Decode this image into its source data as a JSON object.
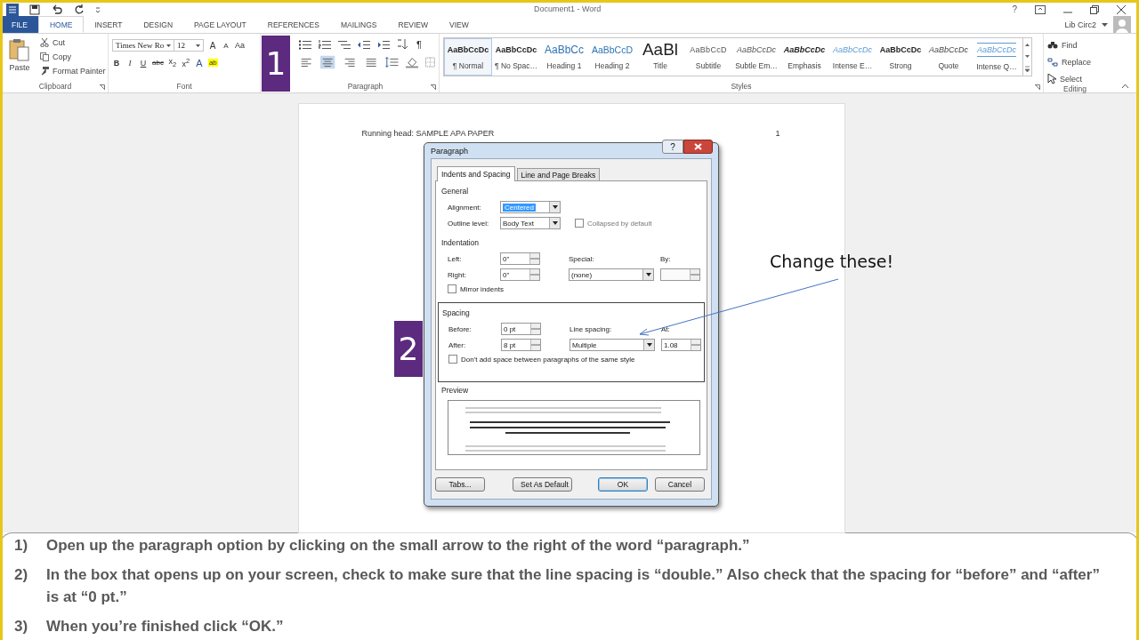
{
  "window": {
    "title": "Document1 - Word",
    "help": "?",
    "user": "Lib Circ2"
  },
  "ribbon_tabs": [
    {
      "label": "FILE",
      "kind": "file",
      "selected": false
    },
    {
      "label": "HOME",
      "kind": "tab",
      "selected": true
    },
    {
      "label": "INSERT",
      "kind": "tab",
      "selected": false
    },
    {
      "label": "DESIGN",
      "kind": "tab",
      "selected": false
    },
    {
      "label": "PAGE LAYOUT",
      "kind": "tab",
      "selected": false
    },
    {
      "label": "REFERENCES",
      "kind": "tab",
      "selected": false
    },
    {
      "label": "MAILINGS",
      "kind": "tab",
      "selected": false
    },
    {
      "label": "REVIEW",
      "kind": "tab",
      "selected": false
    },
    {
      "label": "VIEW",
      "kind": "tab",
      "selected": false
    }
  ],
  "clipboard": {
    "paste": "Paste",
    "cut": "Cut",
    "copy": "Copy",
    "format_painter": "Format Painter",
    "group_label": "Clipboard"
  },
  "font": {
    "name": "Times New Ro",
    "size": "12",
    "grow": "A",
    "shrink": "A",
    "change_case": "Aa",
    "group_label": "Font",
    "buttons": [
      {
        "label": "B",
        "kind": "bold"
      },
      {
        "label": "I",
        "kind": "italic"
      },
      {
        "label": "U",
        "kind": "underline"
      },
      {
        "label": "abc",
        "kind": "strike"
      },
      {
        "label": "x$_{2}$",
        "kind": "plain"
      },
      {
        "label": "x$^{2}$",
        "kind": "plain"
      },
      {
        "label": "A",
        "kind": "effects"
      },
      {
        "label": "ab",
        "kind": "highlight"
      }
    ]
  },
  "paragraph": {
    "group_label": "Paragraph",
    "pilcrow": "¶",
    "alignments": [
      {
        "selected": false
      },
      {
        "selected": true
      },
      {
        "selected": false
      },
      {
        "selected": false
      }
    ]
  },
  "styles": {
    "group_label": "Styles",
    "items": [
      {
        "preview": "AaBbCcDc",
        "label": "¶ Normal",
        "kind": "normal",
        "selected": true
      },
      {
        "preview": "AaBbCcDc",
        "label": "¶ No Spac…",
        "kind": "normal",
        "selected": false
      },
      {
        "preview": "AaBbCc",
        "label": "Heading 1",
        "kind": "heading1",
        "selected": false
      },
      {
        "preview": "AaBbCcD",
        "label": "Heading 2",
        "kind": "heading2",
        "selected": false
      },
      {
        "preview": "AaBl",
        "label": "Title",
        "kind": "title",
        "selected": false
      },
      {
        "preview": "AaBbCcD",
        "label": "Subtitle",
        "kind": "subtitle",
        "selected": false
      },
      {
        "preview": "AaBbCcDc",
        "label": "Subtle Em…",
        "kind": "subtle",
        "selected": false
      },
      {
        "preview": "AaBbCcDc",
        "label": "Emphasis",
        "kind": "emphasis",
        "selected": false
      },
      {
        "preview": "AaBbCcDc",
        "label": "Intense E…",
        "kind": "intense",
        "selected": false
      },
      {
        "preview": "AaBbCcDc",
        "label": "Strong",
        "kind": "strong",
        "selected": false
      },
      {
        "preview": "AaBbCcDc",
        "label": "Quote",
        "kind": "quote",
        "selected": false
      },
      {
        "preview": "AaBbCcDc",
        "label": "Intense Q…",
        "kind": "intense_quote",
        "selected": false
      }
    ]
  },
  "editing": {
    "find": "Find",
    "replace": "Replace",
    "select": "Select",
    "group_label": "Editing"
  },
  "callouts": [
    {
      "label": "1"
    },
    {
      "label": "2"
    }
  ],
  "document": {
    "running_head": "Running head: SAMPLE APA PAPER",
    "page_number": "1"
  },
  "dialog": {
    "title": "Paragraph",
    "help": "?",
    "tabs": [
      {
        "label": "Indents and Spacing",
        "selected": true
      },
      {
        "label": "Line and Page Breaks",
        "selected": false
      }
    ],
    "general": {
      "heading": "General",
      "alignment_label": "Alignment:",
      "alignment": "Centered",
      "outline_label": "Outline level:",
      "outline": "Body Text",
      "collapsed": {
        "label": "Collapsed by default",
        "checked": false
      }
    },
    "indentation": {
      "heading": "Indentation",
      "left_label": "Left:",
      "left": "0\"",
      "right_label": "Right:",
      "right": "0\"",
      "special_label": "Special:",
      "special": "(none)",
      "by_label": "By:",
      "mirror": {
        "label": "Mirror indents",
        "checked": false
      }
    },
    "spacing": {
      "heading": "Spacing",
      "before_label": "Before:",
      "before": "0 pt",
      "after_label": "After:",
      "after": "8 pt",
      "line_label": "Line spacing:",
      "line": "Multiple",
      "at_label": "At:",
      "at": "1.08",
      "dont_add": {
        "label": "Don't add space between paragraphs of the same style",
        "checked": false
      }
    },
    "preview_heading": "Preview",
    "buttons": [
      {
        "label": "Tabs...",
        "kind": "normal"
      },
      {
        "label": "Set As Default",
        "kind": "normal"
      },
      {
        "label": "OK",
        "kind": "default"
      },
      {
        "label": "Cancel",
        "kind": "normal"
      }
    ]
  },
  "annotation": "Change these!",
  "instructions": [
    {
      "number": "1)",
      "text": "Open up the paragraph  option by clicking on the small arrow to the right of the word “paragraph.”"
    },
    {
      "number": "2)",
      "text": "In the box that opens up on your screen, check to make sure that the line spacing is “double.”  Also check that the spacing for “before” and “after” is at “0 pt.”"
    },
    {
      "number": "3)",
      "text": "When you’re finished click “OK.”"
    }
  ]
}
